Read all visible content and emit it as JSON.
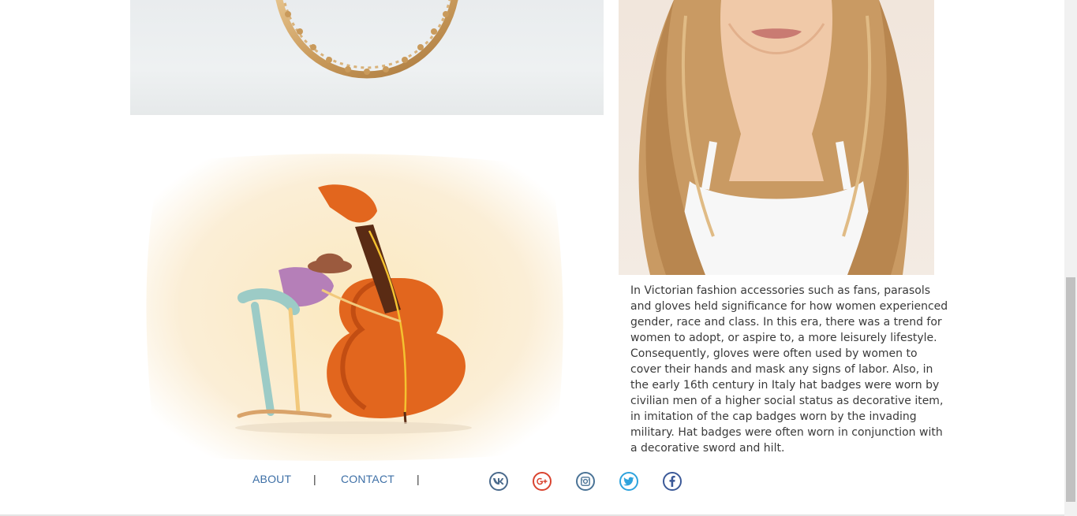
{
  "article": {
    "paragraph": "In Victorian fashion accessories such as fans, parasols and gloves held significance for how women experienced gender, race and class. In this era, there was a trend for women to adopt, or aspire to, a more leisurely lifestyle. Consequently, gloves were often used by women to cover their hands and mask any signs of labor. Also, in the early 16th century in Italy hat badges were worn by civilian men of a higher social status as decorative item, in imitation of the cap badges worn by the invading military. Hat badges were often worn in conjunction with a decorative sword and hilt."
  },
  "footer": {
    "nav": [
      {
        "label": "ABOUT"
      },
      {
        "label": "CONTACT"
      }
    ],
    "separator": "|",
    "social": [
      {
        "icon": "vk-icon",
        "color": "#4a6a8c"
      },
      {
        "icon": "google-plus-icon",
        "color": "#d9432f"
      },
      {
        "icon": "instagram-icon",
        "color": "#4a7396"
      },
      {
        "icon": "twitter-icon",
        "color": "#2ea3dd"
      },
      {
        "icon": "facebook-icon",
        "color": "#3b5998"
      }
    ]
  },
  "colors": {
    "link": "#3d6fa6",
    "text": "#3a3a3a",
    "background": "#ffffff"
  }
}
